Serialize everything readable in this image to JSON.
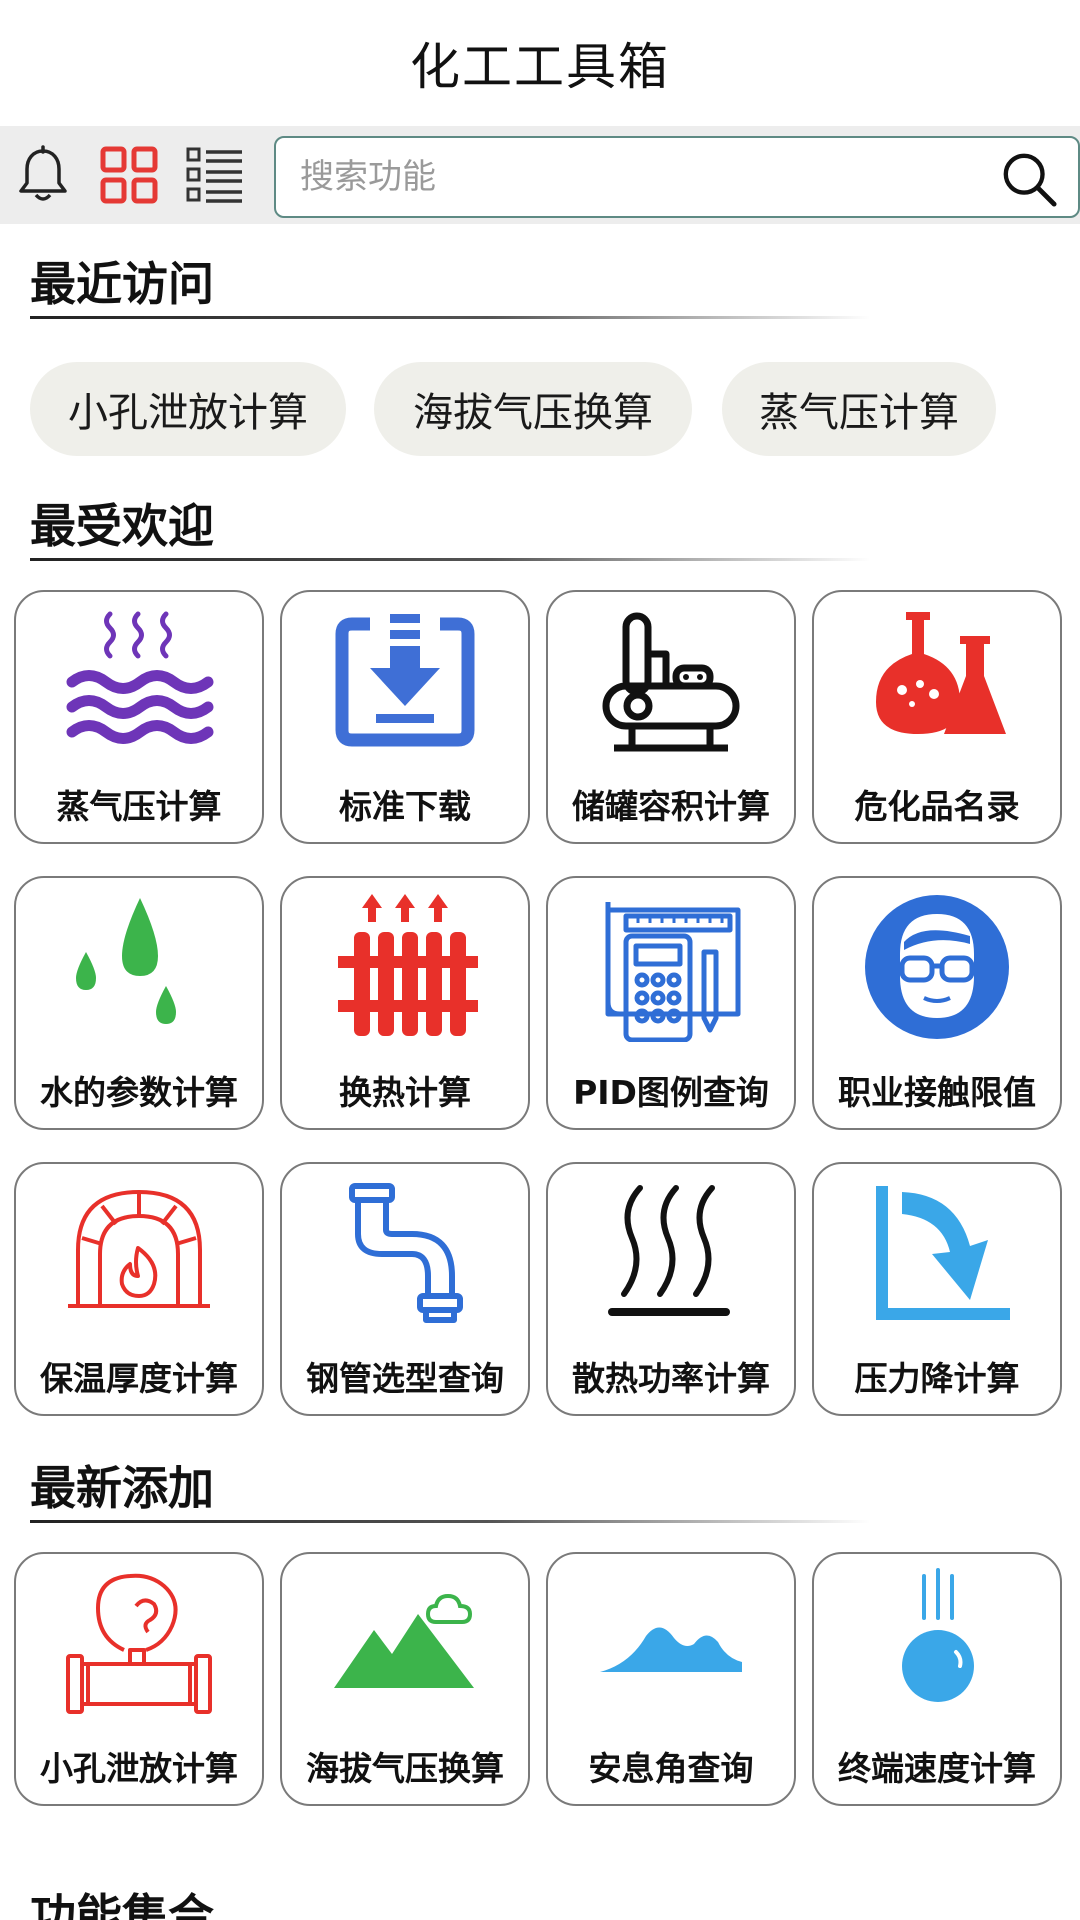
{
  "header": {
    "title": "化工工具箱"
  },
  "toolbar": {
    "search_placeholder": "搜索功能",
    "icons": [
      "bell-icon",
      "grid-view-icon",
      "list-view-icon",
      "search-icon"
    ],
    "active_view": "grid",
    "active_color": "#e53935"
  },
  "recent": {
    "title": "最近访问",
    "items": [
      "小孔泄放计算",
      "海拔气压换算",
      "蒸气压计算"
    ]
  },
  "popular": {
    "title": "最受欢迎",
    "items": [
      {
        "label": "蒸气压计算",
        "icon": "vapor-waves-icon",
        "color": "#6e35b8"
      },
      {
        "label": "标准下载",
        "icon": "download-icon",
        "color": "#3f6fd6"
      },
      {
        "label": "储罐容积计算",
        "icon": "tank-icon",
        "color": "#111111"
      },
      {
        "label": "危化品名录",
        "icon": "flask-icon",
        "color": "#e8302a"
      },
      {
        "label": "水的参数计算",
        "icon": "water-drops-icon",
        "color": "#3cb44b"
      },
      {
        "label": "换热计算",
        "icon": "radiator-icon",
        "color": "#e8302a"
      },
      {
        "label": "PID图例查询",
        "icon": "blueprint-calculator-icon",
        "color": "#2f6ed6"
      },
      {
        "label": "职业接触限值",
        "icon": "safety-goggles-icon",
        "color": "#2f6ed6"
      },
      {
        "label": "保温厚度计算",
        "icon": "furnace-icon",
        "color": "#e8302a"
      },
      {
        "label": "钢管选型查询",
        "icon": "pipe-icon",
        "color": "#2f6ed6"
      },
      {
        "label": "散热功率计算",
        "icon": "heat-waves-icon",
        "color": "#111111"
      },
      {
        "label": "压力降计算",
        "icon": "pressure-drop-icon",
        "color": "#3aa7e8"
      }
    ]
  },
  "newest": {
    "title": "最新添加",
    "items": [
      {
        "label": "小孔泄放计算",
        "icon": "pipe-leak-icon",
        "color": "#e8302a"
      },
      {
        "label": "海拔气压换算",
        "icon": "mountain-icon",
        "color": "#3cb44b"
      },
      {
        "label": "安息角查询",
        "icon": "sand-pile-icon",
        "color": "#3aa7e8"
      },
      {
        "label": "终端速度计算",
        "icon": "falling-ball-icon",
        "color": "#3aa7e8"
      }
    ]
  },
  "collection": {
    "title": "功能集合"
  }
}
